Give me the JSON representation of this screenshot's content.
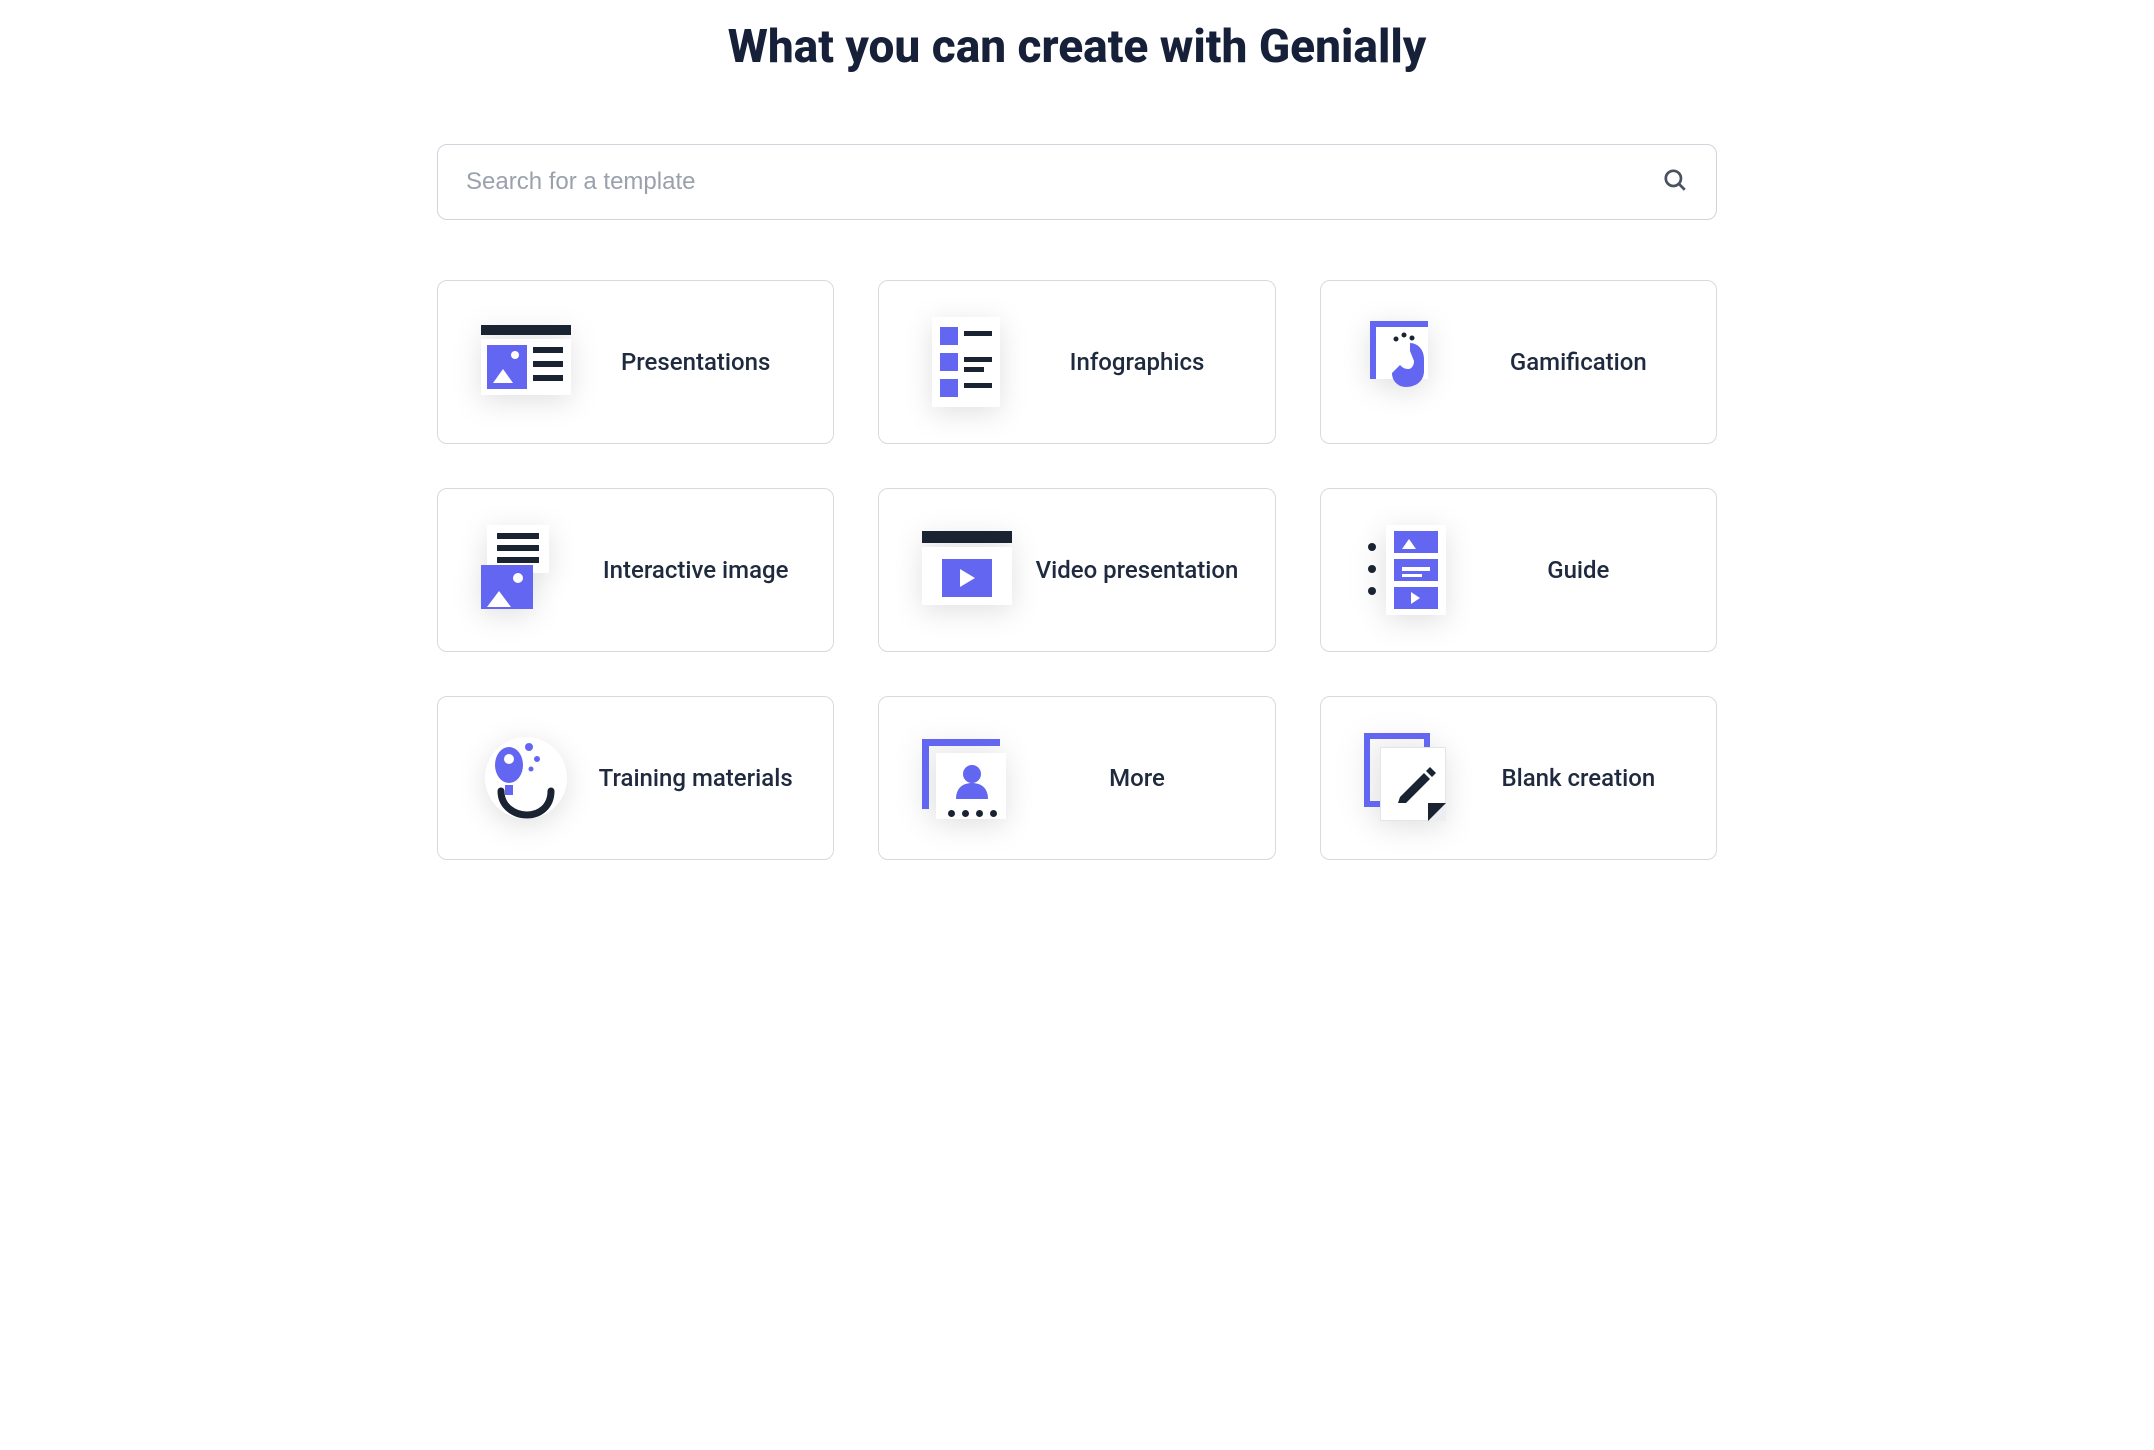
{
  "page_title": "What you can create with Genially",
  "search": {
    "placeholder": "Search for a template"
  },
  "cards": [
    {
      "label": "Presentations",
      "icon": "presentations-icon"
    },
    {
      "label": "Infographics",
      "icon": "infographics-icon"
    },
    {
      "label": "Gamification",
      "icon": "gamification-icon"
    },
    {
      "label": "Interactive image",
      "icon": "interactive-image-icon"
    },
    {
      "label": "Video presentation",
      "icon": "video-presentation-icon"
    },
    {
      "label": "Guide",
      "icon": "guide-icon"
    },
    {
      "label": "Training materials",
      "icon": "training-materials-icon"
    },
    {
      "label": "More",
      "icon": "more-icon"
    },
    {
      "label": "Blank creation",
      "icon": "blank-creation-icon"
    }
  ]
}
